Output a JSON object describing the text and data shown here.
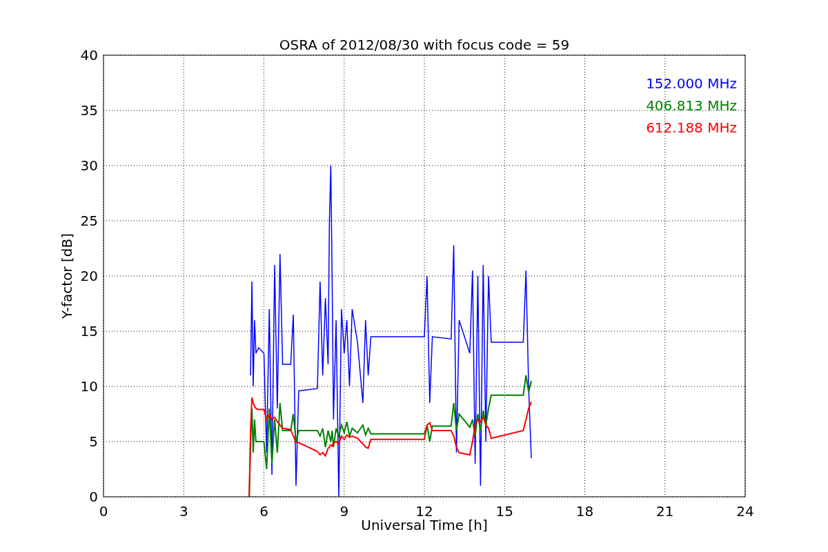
{
  "chart_data": {
    "type": "line",
    "title": "OSRA of 2012/08/30 with focus code = 59",
    "xlabel": "Universal Time [h]",
    "ylabel": "Y-factor [dB]",
    "x": [
      5.45,
      5.5,
      5.55,
      5.6,
      5.65,
      5.7,
      5.8,
      6.0,
      6.1,
      6.2,
      6.3,
      6.4,
      6.5,
      6.6,
      6.7,
      7.0,
      7.1,
      7.2,
      7.3,
      8.0,
      8.1,
      8.2,
      8.3,
      8.4,
      8.45,
      8.5,
      8.55,
      8.6,
      8.7,
      8.8,
      8.9,
      9.0,
      9.1,
      9.2,
      9.3,
      9.5,
      9.7,
      9.8,
      9.9,
      10.0,
      12.0,
      12.1,
      12.2,
      12.3,
      13.0,
      13.1,
      13.2,
      13.3,
      13.7,
      13.8,
      13.9,
      14.0,
      14.1,
      14.2,
      14.3,
      14.4,
      14.5,
      15.7,
      15.8,
      15.9,
      16.0
    ],
    "series": [
      {
        "name": "152.000 MHz",
        "color": "#0000ff",
        "values": [
          null,
          11,
          19.5,
          10,
          16,
          13,
          13.5,
          13,
          4,
          17,
          2,
          21,
          8,
          22,
          12,
          12,
          16.5,
          1,
          9.6,
          9.8,
          19.5,
          11,
          18,
          12,
          25,
          30,
          20,
          7,
          16,
          0,
          17,
          13,
          16,
          10,
          17,
          14,
          8.5,
          16,
          11,
          14.5,
          14.5,
          20,
          8.5,
          14.5,
          14.3,
          22.8,
          4,
          16,
          13,
          20.5,
          3,
          20,
          1,
          21,
          5,
          20,
          14,
          14,
          20.5,
          10,
          3.5
        ]
      },
      {
        "name": "406.813 MHz",
        "color": "#008000",
        "values": [
          0,
          5,
          8,
          4,
          7,
          5,
          5,
          5,
          2.5,
          8,
          3,
          7,
          4,
          8.5,
          6,
          6,
          7.5,
          5,
          6,
          6,
          5.5,
          6.2,
          4.5,
          6,
          5.5,
          5,
          6,
          4.5,
          6.2,
          5.5,
          6.5,
          5.8,
          6.8,
          5.5,
          6.2,
          5.8,
          6.5,
          5.6,
          6.2,
          5.7,
          5.7,
          6.5,
          5,
          6.4,
          6.4,
          8.5,
          6,
          7.5,
          6.3,
          7,
          5.5,
          7.5,
          6,
          7.8,
          6.5,
          8,
          9.2,
          9.2,
          11,
          9.5,
          10.5
        ]
      },
      {
        "name": "612.188 MHz",
        "color": "#ff0000",
        "values": [
          0,
          6,
          9,
          8.5,
          8.2,
          8,
          7.9,
          7.9,
          7,
          7.5,
          7,
          7.2,
          6.8,
          6.5,
          6.2,
          6.1,
          5.5,
          4.9,
          4.9,
          4.1,
          3.8,
          4,
          3.7,
          4.4,
          4.5,
          4.7,
          4.6,
          4.9,
          5,
          4.8,
          5.5,
          5.2,
          5.6,
          5.4,
          5.5,
          5.3,
          4.8,
          4.5,
          4.4,
          5.2,
          5.2,
          6.5,
          6.7,
          6,
          6,
          5.5,
          4.5,
          4,
          3.8,
          5,
          6.5,
          7,
          6.8,
          7.2,
          6.5,
          6.2,
          5.3,
          6,
          7,
          8,
          8.6
        ]
      }
    ],
    "grid": true,
    "xlim": [
      0,
      24
    ],
    "ylim": [
      0,
      40
    ],
    "xticks": [
      0,
      3,
      6,
      9,
      12,
      15,
      18,
      21,
      24
    ],
    "yticks": [
      0,
      5,
      10,
      15,
      20,
      25,
      30,
      35,
      40
    ]
  }
}
